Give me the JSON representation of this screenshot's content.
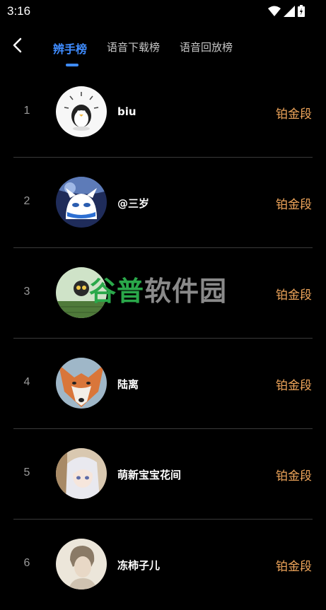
{
  "status_bar": {
    "time": "3:16"
  },
  "header": {
    "tabs": [
      {
        "label": "辨手榜",
        "active": true
      },
      {
        "label": "语音下载榜",
        "active": false
      },
      {
        "label": "语音回放榜",
        "active": false
      }
    ],
    "accent_color": "#3f8cff"
  },
  "rows": [
    {
      "rank": "1",
      "name": "biu",
      "tier": "铂金段"
    },
    {
      "rank": "2",
      "name": "@三岁",
      "tier": "铂金段"
    },
    {
      "rank": "3",
      "name": "",
      "tier": "铂金段"
    },
    {
      "rank": "4",
      "name": "陆离",
      "tier": "铂金段"
    },
    {
      "rank": "5",
      "name": "萌新宝宝花间",
      "tier": "铂金段"
    },
    {
      "rank": "6",
      "name": "冻柿子儿",
      "tier": "铂金段"
    }
  ],
  "tier_color": "#f0a65b",
  "watermark": {
    "part1": "谷普",
    "part2": "软件园"
  }
}
